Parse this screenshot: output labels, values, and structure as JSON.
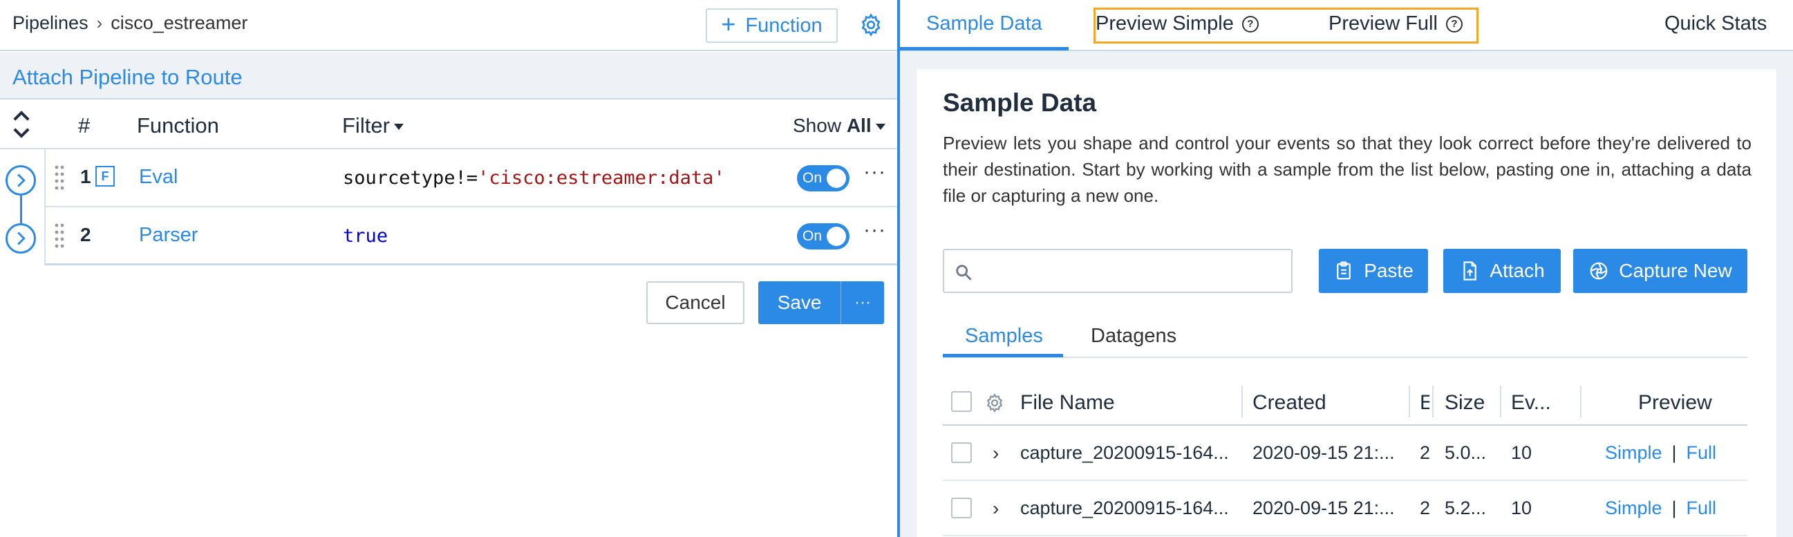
{
  "breadcrumb": {
    "root": "Pipelines",
    "separator": "›",
    "current": "cisco_estreamer"
  },
  "toolbar": {
    "add_function_label": "Function"
  },
  "attach": {
    "link": "Attach Pipeline to Route"
  },
  "functions_table": {
    "headers": {
      "num": "#",
      "function": "Function",
      "filter": "Filter",
      "show_prefix": "Show",
      "show_value": "All"
    },
    "rows": [
      {
        "num": "1",
        "badge": "F",
        "name": "Eval",
        "filter_op": "sourcetype!=",
        "filter_str": "'cisco:estreamer:data'",
        "filter_kw": "",
        "state": "On"
      },
      {
        "num": "2",
        "badge": "",
        "name": "Parser",
        "filter_op": "",
        "filter_str": "",
        "filter_kw": "true",
        "state": "On"
      }
    ]
  },
  "actions": {
    "cancel": "Cancel",
    "save": "Save",
    "more": "···"
  },
  "right_tabs": {
    "sample_data": "Sample Data",
    "preview_simple": "Preview Simple",
    "preview_full": "Preview Full",
    "quick_stats": "Quick Stats",
    "help_glyph": "?"
  },
  "sample_card": {
    "title": "Sample Data",
    "description": "Preview lets you shape and control your events so that they look correct before they're delivered to their destination. Start by working with a sample from the list below, pasting one in, attaching a data file or capturing a new one.",
    "search_placeholder": "",
    "buttons": {
      "paste": "Paste",
      "attach": "Attach",
      "capture": "Capture New"
    },
    "subtabs": {
      "samples": "Samples",
      "datagens": "Datagens"
    },
    "table": {
      "headers": {
        "file_name": "File Name",
        "created": "Created",
        "e": "E",
        "size": "Size",
        "events": "Ev...",
        "preview": "Preview"
      },
      "rows": [
        {
          "file_name": "capture_20200915-164...",
          "created": "2020-09-15 21:...",
          "e": "2",
          "size": "5.0...",
          "events": "10",
          "simple": "Simple",
          "full": "Full"
        },
        {
          "file_name": "capture_20200915-164...",
          "created": "2020-09-15 21:...",
          "e": "2",
          "size": "5.2...",
          "events": "10",
          "simple": "Simple",
          "full": "Full"
        }
      ]
    }
  },
  "colors": {
    "accent": "#2b8ae6",
    "highlight": "#f5a623",
    "string": "#a31515",
    "keyword": "#0000cc"
  }
}
